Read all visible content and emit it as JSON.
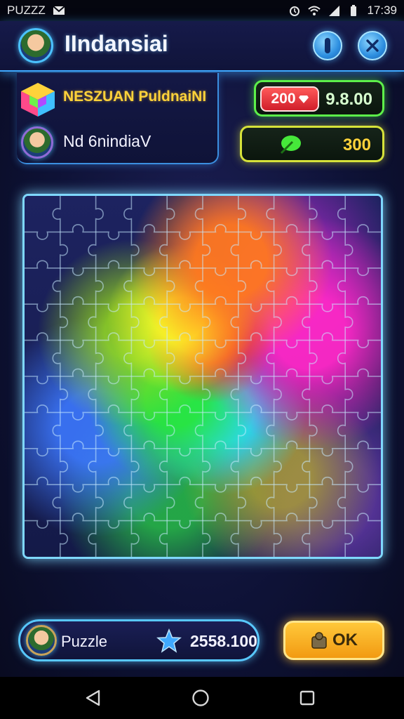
{
  "status_bar": {
    "app_label": "PUZZZ",
    "time": "17:39",
    "icons": [
      "mail-icon",
      "alarm-icon",
      "wifi-icon",
      "signal-icon",
      "battery-icon"
    ]
  },
  "header": {
    "title": "IIndansiai",
    "icons": [
      "avatar",
      "info-icon",
      "close-icon"
    ]
  },
  "profile": {
    "level_title": "NESZUAN PuldnaiNI",
    "player_name": "Nd 6nindiaV"
  },
  "counters": {
    "gems": "200",
    "coins": "9.8.00",
    "leaves": "300"
  },
  "board": {
    "columns": 10,
    "rows": 10,
    "colors": {
      "orange": "#ff7a1e",
      "yellow": "#ffff28",
      "red": "#ff321e",
      "magenta": "#ff28c8",
      "green": "#28e63c",
      "cyan": "#28dcff",
      "blue": "#3c78ff",
      "frame": "#7fd8ff"
    }
  },
  "footer": {
    "puzzle_label": "Puzzle",
    "score": "2558.100",
    "ok_label": "OK"
  },
  "nav": {
    "icons": [
      "back-icon",
      "home-icon",
      "recents-icon"
    ]
  },
  "theme": {
    "accent_blue": "#3fa9ff",
    "accent_green": "#5df04a",
    "accent_gold": "#ffc83a",
    "background": "#0e1236"
  }
}
